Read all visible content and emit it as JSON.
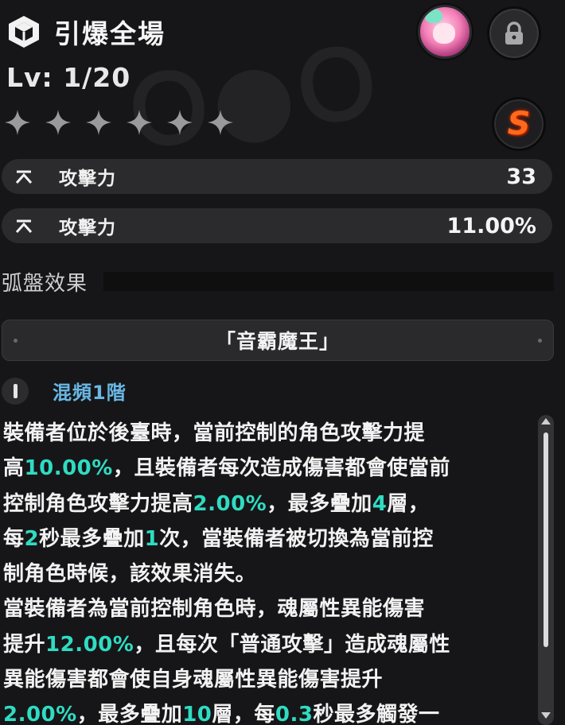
{
  "header": {
    "title": "引爆全場",
    "cube_icon": "cube-icon"
  },
  "level": {
    "text": "Lv: 1/20"
  },
  "stars": {
    "count": 6,
    "filled": 0,
    "icon": "star-icon"
  },
  "rank": {
    "letter": "S",
    "color": "#ff6a1a"
  },
  "stats": [
    {
      "icon": "chevron-up-icon",
      "name": "攻擊力",
      "value": "33"
    },
    {
      "icon": "chevron-up-icon",
      "name": "攻擊力",
      "value": "11.00%"
    }
  ],
  "section": {
    "title": "弧盤效果"
  },
  "set": {
    "name": "「音霸魔王」"
  },
  "tier": {
    "label": "混頻1階"
  },
  "description": {
    "lines": [
      [
        {
          "t": "裝備者位於後臺時，當前控制的角色攻擊力提"
        }
      ],
      [
        {
          "t": "高"
        },
        {
          "t": "10.00%",
          "h": true
        },
        {
          "t": "，且裝備者每次造成傷害都會使當前"
        }
      ],
      [
        {
          "t": "控制角色攻擊力提高"
        },
        {
          "t": "2.00%",
          "h": true
        },
        {
          "t": "，最多疊加"
        },
        {
          "t": "4",
          "h": true
        },
        {
          "t": "層，"
        }
      ],
      [
        {
          "t": "每"
        },
        {
          "t": "2",
          "h": true
        },
        {
          "t": "秒最多疊加"
        },
        {
          "t": "1",
          "h": true
        },
        {
          "t": "次，當裝備者被切換為當前控"
        }
      ],
      [
        {
          "t": "制角色時候，該效果消失。"
        }
      ],
      [
        {
          "t": "當裝備者為當前控制角色時，魂屬性異能傷害"
        }
      ],
      [
        {
          "t": "提升"
        },
        {
          "t": "12.00%",
          "h": true
        },
        {
          "t": "，且每次「普通攻擊」造成魂屬性"
        }
      ],
      [
        {
          "t": "異能傷害都會使自身魂屬性異能傷害提升"
        }
      ],
      [
        {
          "t": "2.00%",
          "h": true
        },
        {
          "t": "，最多疊加"
        },
        {
          "t": "10",
          "h": true
        },
        {
          "t": "層，每"
        },
        {
          "t": "0.3",
          "h": true
        },
        {
          "t": "秒最多觸發一"
        }
      ]
    ],
    "highlight_color": "#2fdcc2"
  },
  "scrollbar": {
    "position": "top"
  }
}
